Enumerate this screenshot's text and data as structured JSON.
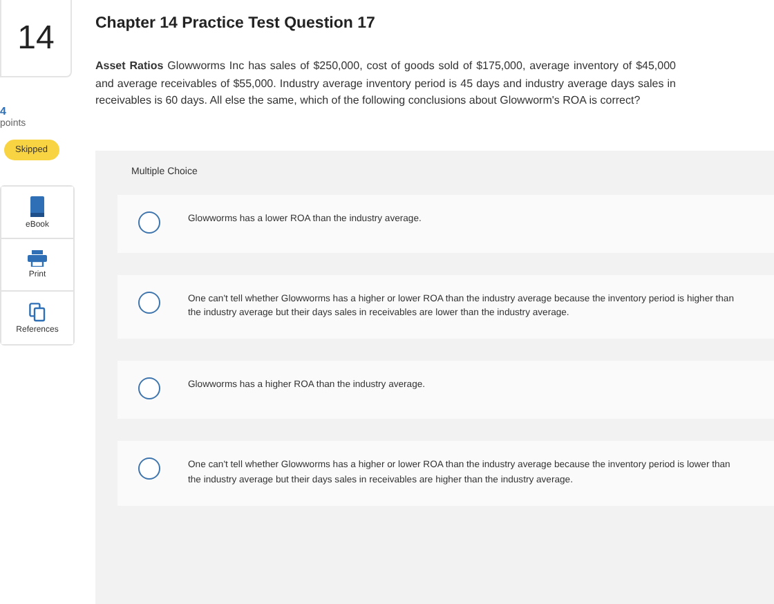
{
  "question_number": "14",
  "points": {
    "value": "4",
    "label": "points"
  },
  "status_badge": "Skipped",
  "tools": [
    {
      "kind": "ebook",
      "label": "eBook"
    },
    {
      "kind": "print",
      "label": "Print"
    },
    {
      "kind": "references",
      "label": "References"
    }
  ],
  "title": "Chapter 14 Practice Test Question 17",
  "question": "**Asset Ratios** Glowworms Inc has sales of $250,000, cost of goods sold of $175,000, average inventory of $45,000 and average receivables of $55,000. Industry average inventory period is 45 days and industry average days sales in receivables is 60 days. All else the same, which of the following conclusions about Glowworm's ROA is correct?",
  "answer_type": "Multiple Choice",
  "options": [
    {
      "text": "Glowworms has a lower ROA than the industry average.",
      "selected": false
    },
    {
      "text": "One can't tell whether Glowworms has a higher or lower ROA than the industry average because the inventory period is higher than the industry average but their days sales in receivables are lower than the industry average.",
      "selected": false
    },
    {
      "text": "Glowworms has a higher ROA than the industry average.",
      "selected": false
    },
    {
      "text": "One can't tell whether Glowworms has a higher or lower ROA than the industry average because the inventory period is lower than the industry average but their days sales in receivables are higher than the industry average.",
      "selected": false
    }
  ]
}
